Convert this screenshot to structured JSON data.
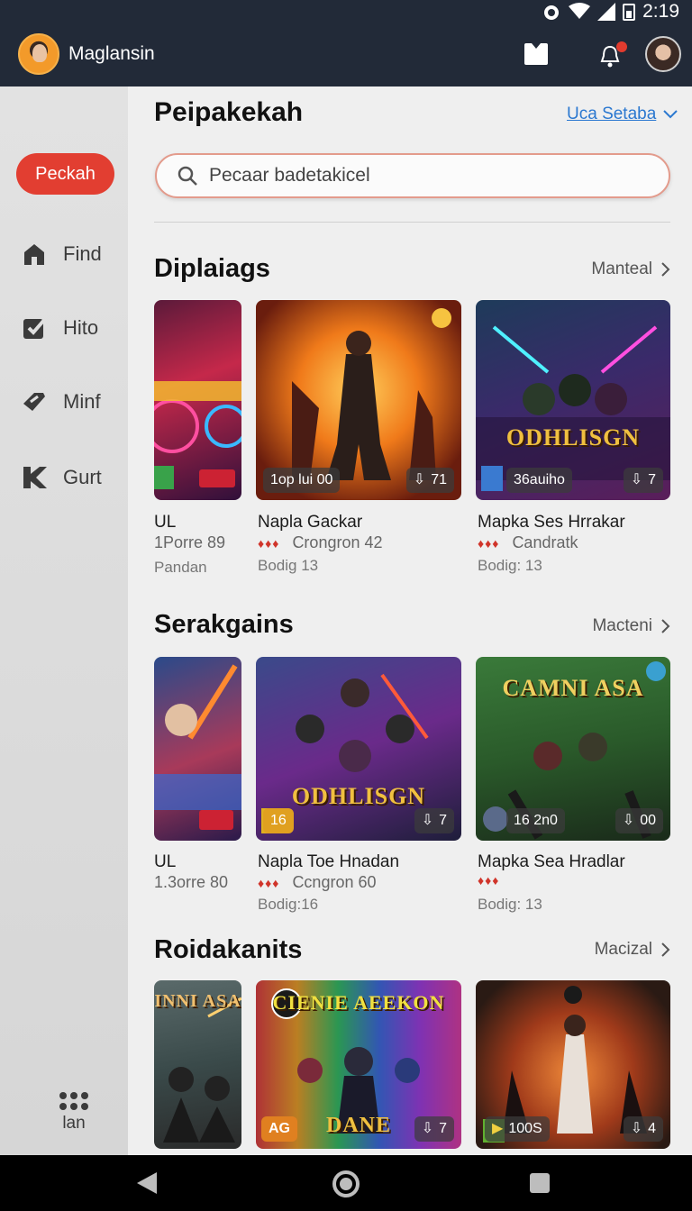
{
  "status_bar": {
    "time": "2:19"
  },
  "app_bar": {
    "app_name": "Maglansin"
  },
  "sidebar": {
    "primary_button": "Peckah",
    "items": [
      {
        "label": "Find",
        "icon": "home-icon"
      },
      {
        "label": "Hito",
        "icon": "checkbox-icon"
      },
      {
        "label": "Minf",
        "icon": "tag-icon"
      },
      {
        "label": "Gurt",
        "icon": "k-icon"
      }
    ],
    "bottom_label": "lan"
  },
  "header": {
    "title": "Peipakekah",
    "link_label": "Uca Setaba"
  },
  "search": {
    "placeholder": "Pecaar badetakicel"
  },
  "sections": [
    {
      "title": "Diplaiags",
      "more_label": "Manteal",
      "games": [
        {
          "title": "UL",
          "meta": "1Porre 89",
          "sub": "Pandan",
          "badge_left": "",
          "badge_right": ""
        },
        {
          "title": "Napla Gackar",
          "meta": "Crongron 42",
          "sub": "Bodig 13",
          "badge_left": "1op lui 00",
          "badge_right": "71"
        },
        {
          "title": "Mapka Ses Hrrakar",
          "meta": "Candratk",
          "sub": "Bodig: 13",
          "badge_left": "36auiho",
          "badge_right": "7",
          "art_text": "ODHLISGN"
        }
      ]
    },
    {
      "title": "Serakgains",
      "more_label": "Macteni",
      "games": [
        {
          "title": "UL",
          "meta": "1.3orre 80",
          "sub": "",
          "badge_left": "",
          "badge_right": ""
        },
        {
          "title": "Napla Toe Hnadan",
          "meta": "Ccngron 60",
          "sub": "Bodig:16",
          "badge_left": "16",
          "badge_right": "7",
          "art_text": "ODHLISGN"
        },
        {
          "title": "Mapka Sea Hradlar",
          "meta": "",
          "sub": "Bodig: 13",
          "badge_left": "16 2n0",
          "badge_right": "00",
          "art_text": "CAMNI ASA"
        }
      ]
    },
    {
      "title": "Roidakanits",
      "more_label": "Macizal",
      "games": [
        {
          "badge_left": "",
          "badge_right": "",
          "art_text": "INNI ASA"
        },
        {
          "badge_left": "AG",
          "badge_right": "7",
          "art_text": "CIENIE AEEKON",
          "art_text_2": "DANE"
        },
        {
          "badge_left": "100S",
          "badge_right": "4"
        }
      ]
    }
  ]
}
